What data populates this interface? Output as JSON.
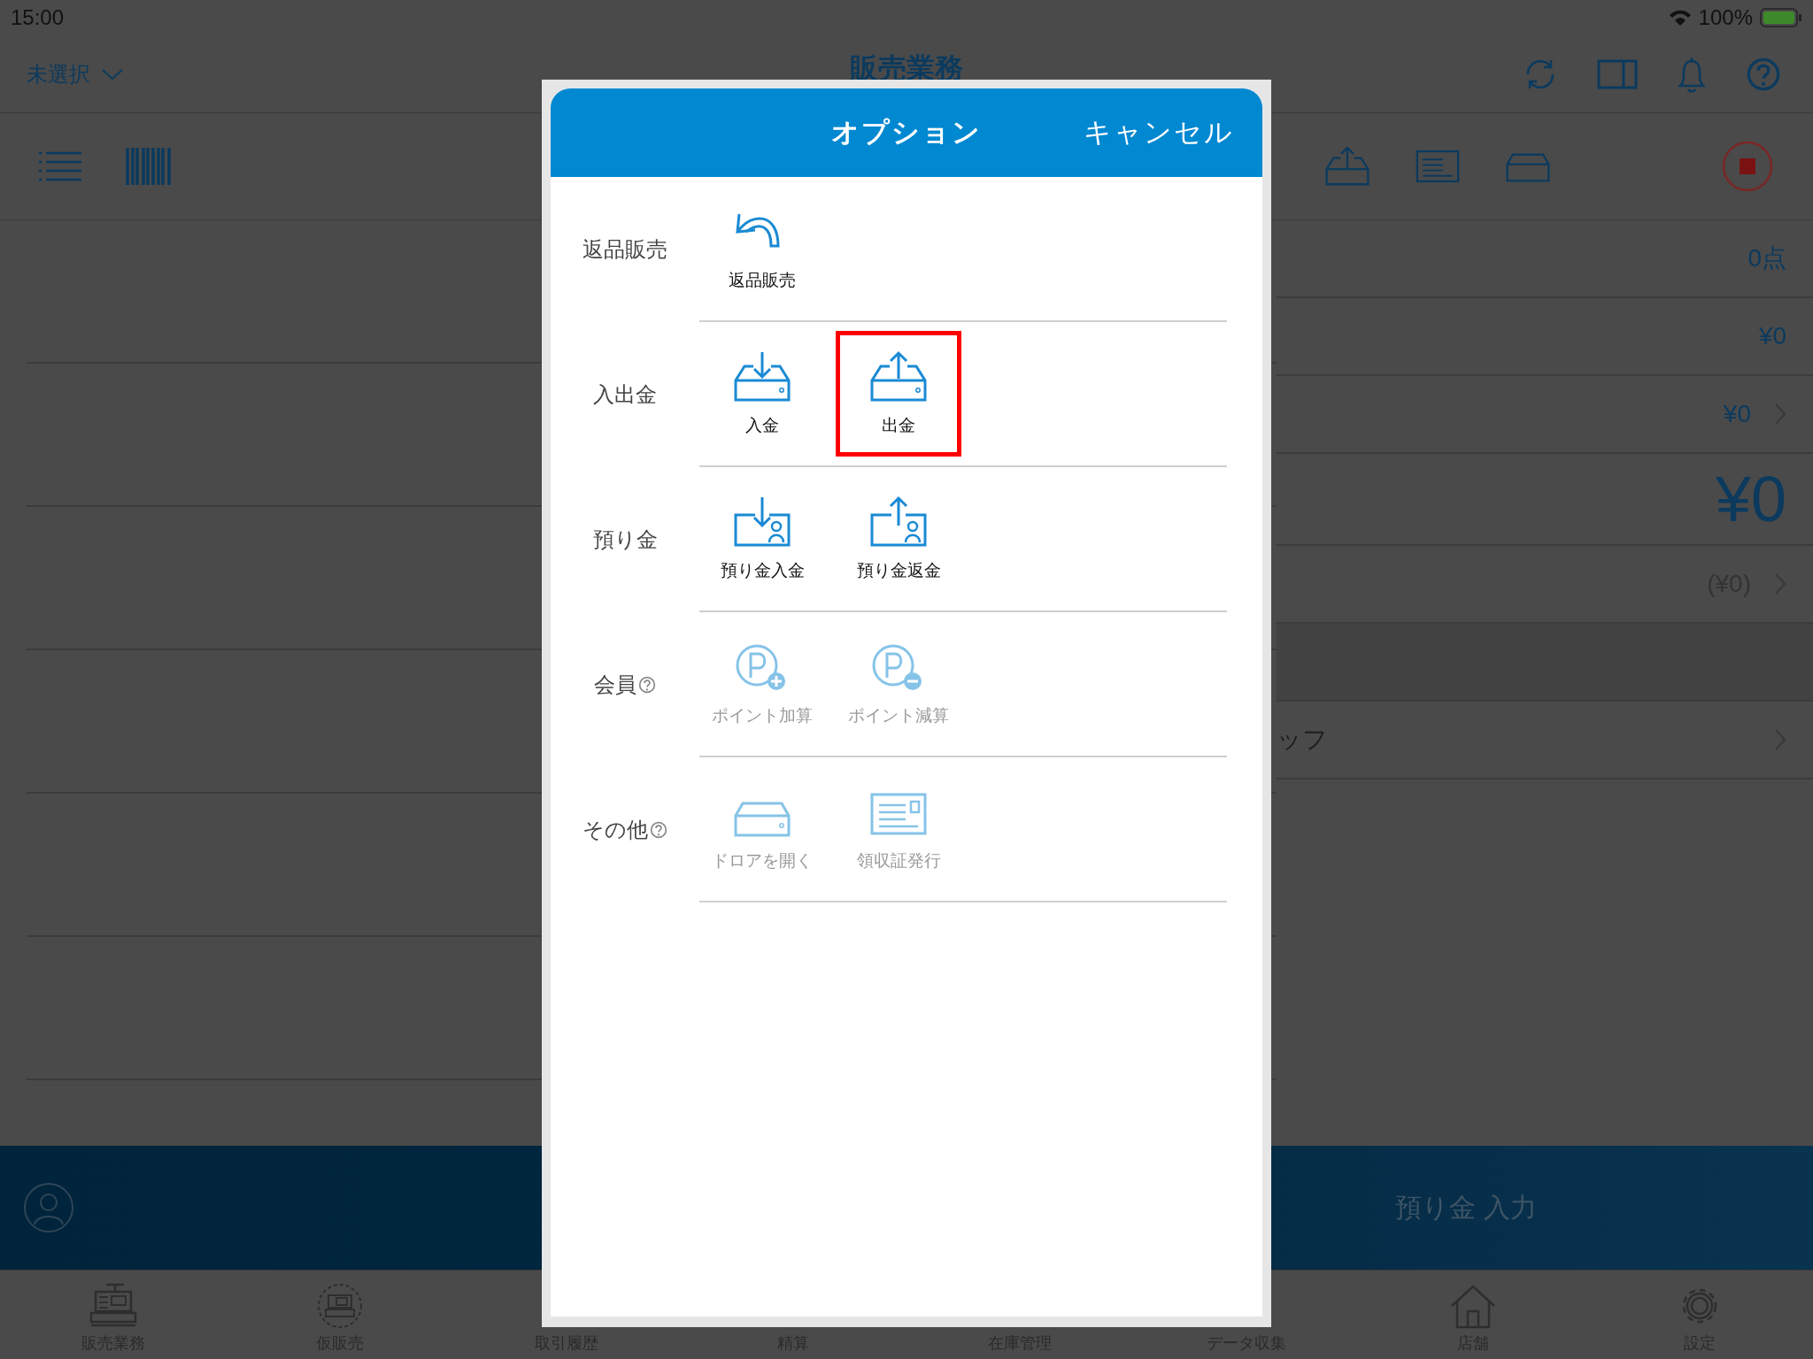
{
  "status_bar": {
    "time": "15:00",
    "battery": "100%"
  },
  "nav": {
    "store": "未選択",
    "title": "販売業務"
  },
  "summary": [
    {
      "kind": "count",
      "value": "0点",
      "chevron": false
    },
    {
      "kind": "amount",
      "value": "¥0",
      "chevron": false
    },
    {
      "kind": "amount",
      "value": "¥0",
      "chevron": true
    },
    {
      "kind": "total",
      "value": "¥0",
      "chevron": false
    },
    {
      "kind": "muted",
      "value": "(¥0)",
      "chevron": true
    },
    {
      "kind": "blank",
      "chevron": false
    },
    {
      "kind": "label",
      "value": "ッフ",
      "chevron": true
    }
  ],
  "action_bar": {
    "label": "預り金 入力"
  },
  "tabs": [
    {
      "label": "販売業務",
      "kind": "register"
    },
    {
      "label": "仮販売",
      "kind": "temp-register"
    },
    {
      "label": "取引履歴"
    },
    {
      "label": "精算"
    },
    {
      "label": "在庫管理"
    },
    {
      "label": "データ収集"
    },
    {
      "label": "店舗",
      "kind": "home"
    },
    {
      "label": "設定",
      "kind": "gear"
    }
  ],
  "modal": {
    "title": "オプション",
    "cancel": "キャンセル",
    "sections": [
      {
        "label": "返品販売",
        "help": false,
        "items": [
          {
            "kind": "return",
            "label": "返品販売",
            "disabled": false,
            "highlighted": false
          }
        ]
      },
      {
        "label": "入出金",
        "help": false,
        "items": [
          {
            "kind": "tray-in",
            "label": "入金",
            "disabled": false,
            "highlighted": false
          },
          {
            "kind": "tray-out",
            "label": "出金",
            "disabled": false,
            "highlighted": true
          }
        ]
      },
      {
        "label": "預り金",
        "help": false,
        "items": [
          {
            "kind": "deposit-in",
            "label": "預り金入金",
            "disabled": false,
            "highlighted": false
          },
          {
            "kind": "deposit-out",
            "label": "預り金返金",
            "disabled": false,
            "highlighted": false
          }
        ]
      },
      {
        "label": "会員",
        "help": true,
        "items": [
          {
            "kind": "point-plus",
            "label": "ポイント加算",
            "disabled": true,
            "highlighted": false
          },
          {
            "kind": "point-minus",
            "label": "ポイント減算",
            "disabled": true,
            "highlighted": false
          }
        ]
      },
      {
        "label": "その他",
        "help": true,
        "items": [
          {
            "kind": "drawer",
            "label": "ドロアを開く",
            "disabled": true,
            "highlighted": false
          },
          {
            "kind": "receipt",
            "label": "領収証発行",
            "disabled": true,
            "highlighted": false
          }
        ]
      }
    ]
  }
}
